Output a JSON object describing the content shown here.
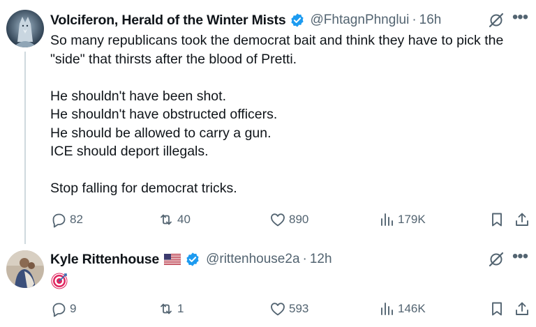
{
  "tweets": [
    {
      "author_name": "Volciferon, Herald of the Winter Mists",
      "handle": "@FhtagnPhnglui",
      "separator": "·",
      "time": "16h",
      "lines": [
        "So many republicans took the democrat bait and think they have to pick the",
        "\"side\" that thirsts after the blood of Pretti.",
        "",
        "He shouldn't have been shot.",
        "He shouldn't have obstructed officers.",
        "He should be allowed to carry a gun.",
        "ICE should deport illegals.",
        "",
        "Stop falling for democrat tricks."
      ],
      "replies": "82",
      "reposts": "40",
      "likes": "890",
      "views": "179K"
    },
    {
      "author_name": "Kyle Rittenhouse",
      "handle": "@rittenhouse2a",
      "separator": "·",
      "time": "12h",
      "emoji": "direct-hit-target",
      "replies": "9",
      "reposts": "1",
      "likes": "593",
      "views": "146K"
    }
  ],
  "colors": {
    "text": "#0f1419",
    "secondary": "#536471",
    "verified_blue": "#1d9bf0",
    "thread_line": "#cfd9de"
  },
  "icons": [
    "verified-badge-icon",
    "us-flag-icon",
    "grok-icon",
    "more-icon",
    "reply-icon",
    "repost-icon",
    "like-icon",
    "views-icon",
    "bookmark-icon",
    "share-icon"
  ]
}
